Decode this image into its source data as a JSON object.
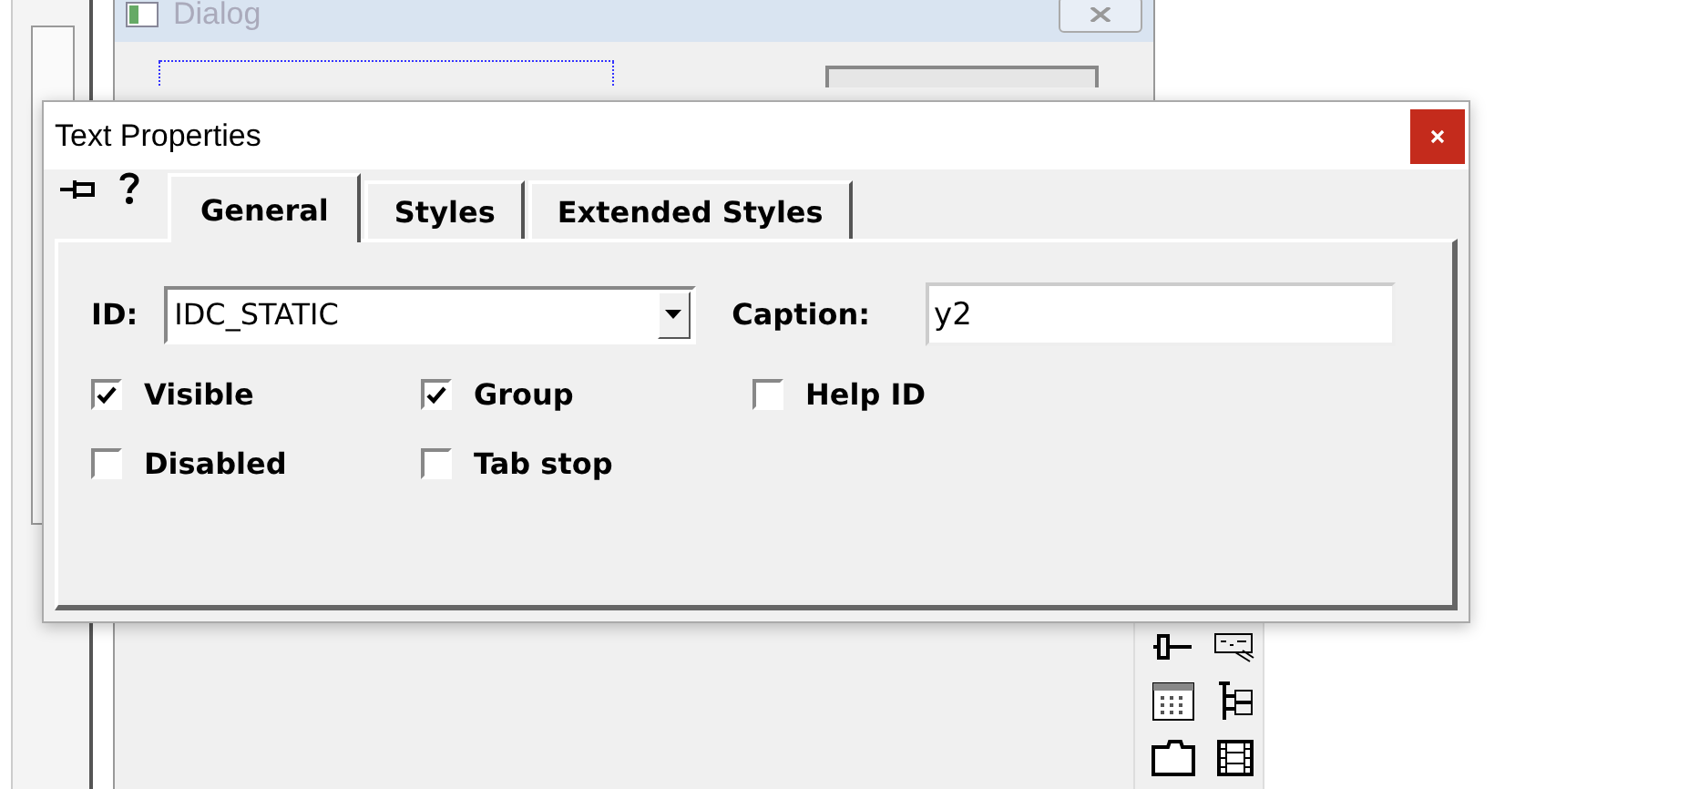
{
  "background_dialog": {
    "title": "Dialog"
  },
  "window": {
    "title": "Text Properties"
  },
  "tabs": [
    {
      "label": "General",
      "selected": true
    },
    {
      "label": "Styles",
      "selected": false
    },
    {
      "label": "Extended Styles",
      "selected": false
    }
  ],
  "id_field": {
    "label": "ID:",
    "value": "IDC_STATIC"
  },
  "caption_field": {
    "label": "Caption:",
    "value": "y2"
  },
  "checkboxes": [
    {
      "label": "Visible",
      "checked": true
    },
    {
      "label": "Group",
      "checked": true
    },
    {
      "label": "Help ID",
      "checked": false
    },
    {
      "label": "Disabled",
      "checked": false
    },
    {
      "label": "Tab stop",
      "checked": false
    }
  ]
}
